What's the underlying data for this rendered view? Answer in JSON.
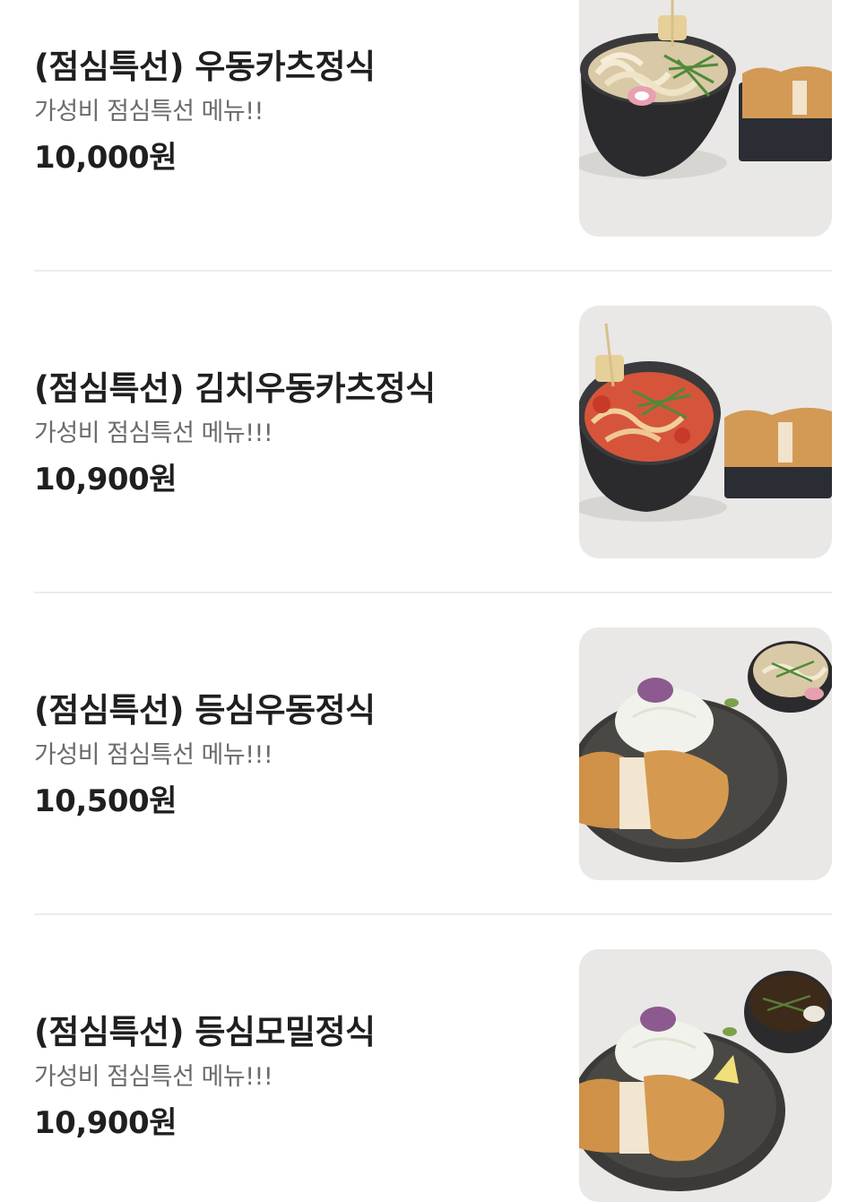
{
  "menu": {
    "items": [
      {
        "name": "(점심특선) 우동카츠정식",
        "description": "가성비 점심특선 메뉴!!",
        "price": "10,000원",
        "image": "udon-katsu-set-photo"
      },
      {
        "name": "(점심특선) 김치우동카츠정식",
        "description": "가성비 점심특선 메뉴!!!",
        "price": "10,900원",
        "image": "kimchi-udon-katsu-set-photo"
      },
      {
        "name": "(점심특선) 등심우동정식",
        "description": "가성비 점심특선 메뉴!!!",
        "price": "10,500원",
        "image": "loin-cutlet-udon-set-photo"
      },
      {
        "name": "(점심특선) 등심모밀정식",
        "description": "가성비 점심특선 메뉴!!!",
        "price": "10,900원",
        "image": "loin-cutlet-soba-set-photo"
      }
    ]
  },
  "colors": {
    "text_primary": "#1f1f1f",
    "text_secondary": "#6b6b6b",
    "divider": "#ececec",
    "background": "#ffffff"
  }
}
